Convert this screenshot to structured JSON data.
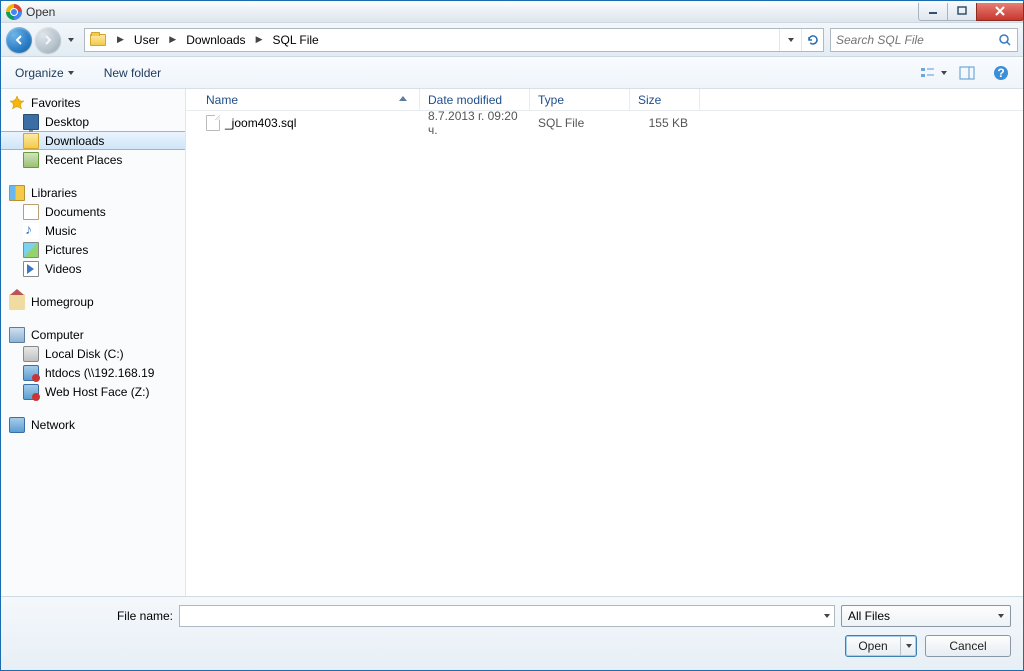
{
  "window": {
    "title": "Open"
  },
  "breadcrumb": [
    "User",
    "Downloads",
    "SQL File"
  ],
  "search": {
    "placeholder": "Search SQL File"
  },
  "toolbar": {
    "organize": "Organize",
    "newfolder": "New folder"
  },
  "columns": {
    "name": "Name",
    "date": "Date modified",
    "type": "Type",
    "size": "Size"
  },
  "files": [
    {
      "name": "_joom403.sql",
      "date": "8.7.2013 г. 09:20 ч.",
      "type": "SQL File",
      "size": "155 KB"
    }
  ],
  "sidebar": {
    "favorites": {
      "label": "Favorites",
      "items": [
        "Desktop",
        "Downloads",
        "Recent Places"
      ],
      "selectedIndex": 1
    },
    "libraries": {
      "label": "Libraries",
      "items": [
        "Documents",
        "Music",
        "Pictures",
        "Videos"
      ]
    },
    "homegroup": {
      "label": "Homegroup"
    },
    "computer": {
      "label": "Computer",
      "items": [
        "Local Disk (C:)",
        "htdocs (\\\\192.168.19",
        "Web Host Face (Z:)"
      ]
    },
    "network": {
      "label": "Network"
    }
  },
  "footer": {
    "filename_label": "File name:",
    "filename_value": "",
    "filetype": "All Files",
    "open": "Open",
    "cancel": "Cancel"
  }
}
